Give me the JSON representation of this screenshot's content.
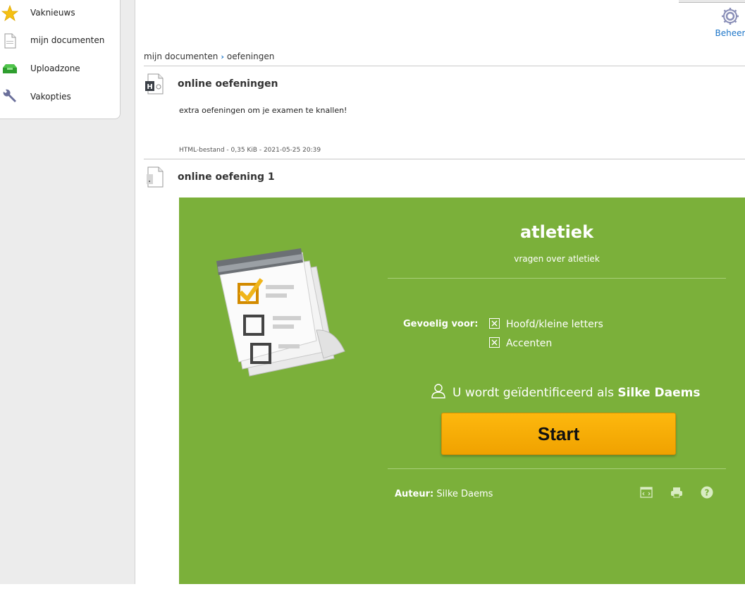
{
  "sidebar": {
    "items": [
      {
        "label": "Vaknieuws",
        "icon": "star-icon"
      },
      {
        "label": "mijn documenten",
        "icon": "document-icon"
      },
      {
        "label": "Uploadzone",
        "icon": "upload-tray-icon"
      },
      {
        "label": "Vakopties",
        "icon": "wrench-icon"
      }
    ]
  },
  "header": {
    "admin_label": "Beheer",
    "admin_icon": "gear-icon"
  },
  "breadcrumb": {
    "items": [
      "mijn documenten",
      "oefeningen"
    ]
  },
  "documents": [
    {
      "title": "online oefeningen",
      "icon": "html-file-icon",
      "description": "extra oefeningen om je examen te knallen!",
      "meta": "HTML-bestand - 0,35 KiB - 2021-05-25 20:39"
    },
    {
      "title": "online oefening 1",
      "icon": "exercise-file-icon"
    }
  ],
  "exercise": {
    "title": "atletiek",
    "subtitle": "vragen over atletiek",
    "sensitive_label": "Gevoelig voor:",
    "options": [
      "Hoofd/kleine letters",
      "Accenten"
    ],
    "identified_prefix": "U wordt geïdentificeerd als",
    "user_name": "Silke Daems",
    "start_label": "Start",
    "author_label": "Auteur:",
    "author_name": "Silke Daems",
    "footer_icons": [
      "embed-icon",
      "print-icon",
      "help-icon"
    ],
    "background_color": "#7bb03a",
    "button_color": "#fdb80e"
  }
}
